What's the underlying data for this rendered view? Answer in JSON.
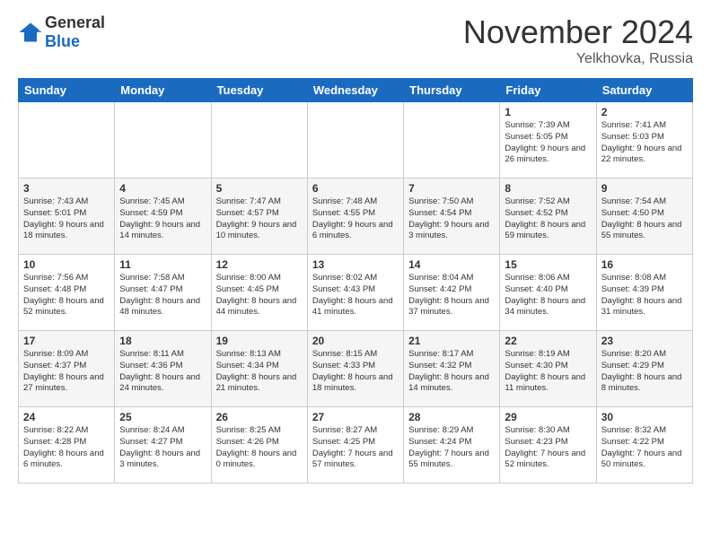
{
  "logo": {
    "general": "General",
    "blue": "Blue"
  },
  "header": {
    "month": "November 2024",
    "location": "Yelkhovka, Russia"
  },
  "days_of_week": [
    "Sunday",
    "Monday",
    "Tuesday",
    "Wednesday",
    "Thursday",
    "Friday",
    "Saturday"
  ],
  "weeks": [
    [
      {
        "day": "",
        "info": ""
      },
      {
        "day": "",
        "info": ""
      },
      {
        "day": "",
        "info": ""
      },
      {
        "day": "",
        "info": ""
      },
      {
        "day": "",
        "info": ""
      },
      {
        "day": "1",
        "info": "Sunrise: 7:39 AM\nSunset: 5:05 PM\nDaylight: 9 hours and 26 minutes."
      },
      {
        "day": "2",
        "info": "Sunrise: 7:41 AM\nSunset: 5:03 PM\nDaylight: 9 hours and 22 minutes."
      }
    ],
    [
      {
        "day": "3",
        "info": "Sunrise: 7:43 AM\nSunset: 5:01 PM\nDaylight: 9 hours and 18 minutes."
      },
      {
        "day": "4",
        "info": "Sunrise: 7:45 AM\nSunset: 4:59 PM\nDaylight: 9 hours and 14 minutes."
      },
      {
        "day": "5",
        "info": "Sunrise: 7:47 AM\nSunset: 4:57 PM\nDaylight: 9 hours and 10 minutes."
      },
      {
        "day": "6",
        "info": "Sunrise: 7:48 AM\nSunset: 4:55 PM\nDaylight: 9 hours and 6 minutes."
      },
      {
        "day": "7",
        "info": "Sunrise: 7:50 AM\nSunset: 4:54 PM\nDaylight: 9 hours and 3 minutes."
      },
      {
        "day": "8",
        "info": "Sunrise: 7:52 AM\nSunset: 4:52 PM\nDaylight: 8 hours and 59 minutes."
      },
      {
        "day": "9",
        "info": "Sunrise: 7:54 AM\nSunset: 4:50 PM\nDaylight: 8 hours and 55 minutes."
      }
    ],
    [
      {
        "day": "10",
        "info": "Sunrise: 7:56 AM\nSunset: 4:48 PM\nDaylight: 8 hours and 52 minutes."
      },
      {
        "day": "11",
        "info": "Sunrise: 7:58 AM\nSunset: 4:47 PM\nDaylight: 8 hours and 48 minutes."
      },
      {
        "day": "12",
        "info": "Sunrise: 8:00 AM\nSunset: 4:45 PM\nDaylight: 8 hours and 44 minutes."
      },
      {
        "day": "13",
        "info": "Sunrise: 8:02 AM\nSunset: 4:43 PM\nDaylight: 8 hours and 41 minutes."
      },
      {
        "day": "14",
        "info": "Sunrise: 8:04 AM\nSunset: 4:42 PM\nDaylight: 8 hours and 37 minutes."
      },
      {
        "day": "15",
        "info": "Sunrise: 8:06 AM\nSunset: 4:40 PM\nDaylight: 8 hours and 34 minutes."
      },
      {
        "day": "16",
        "info": "Sunrise: 8:08 AM\nSunset: 4:39 PM\nDaylight: 8 hours and 31 minutes."
      }
    ],
    [
      {
        "day": "17",
        "info": "Sunrise: 8:09 AM\nSunset: 4:37 PM\nDaylight: 8 hours and 27 minutes."
      },
      {
        "day": "18",
        "info": "Sunrise: 8:11 AM\nSunset: 4:36 PM\nDaylight: 8 hours and 24 minutes."
      },
      {
        "day": "19",
        "info": "Sunrise: 8:13 AM\nSunset: 4:34 PM\nDaylight: 8 hours and 21 minutes."
      },
      {
        "day": "20",
        "info": "Sunrise: 8:15 AM\nSunset: 4:33 PM\nDaylight: 8 hours and 18 minutes."
      },
      {
        "day": "21",
        "info": "Sunrise: 8:17 AM\nSunset: 4:32 PM\nDaylight: 8 hours and 14 minutes."
      },
      {
        "day": "22",
        "info": "Sunrise: 8:19 AM\nSunset: 4:30 PM\nDaylight: 8 hours and 11 minutes."
      },
      {
        "day": "23",
        "info": "Sunrise: 8:20 AM\nSunset: 4:29 PM\nDaylight: 8 hours and 8 minutes."
      }
    ],
    [
      {
        "day": "24",
        "info": "Sunrise: 8:22 AM\nSunset: 4:28 PM\nDaylight: 8 hours and 6 minutes."
      },
      {
        "day": "25",
        "info": "Sunrise: 8:24 AM\nSunset: 4:27 PM\nDaylight: 8 hours and 3 minutes."
      },
      {
        "day": "26",
        "info": "Sunrise: 8:25 AM\nSunset: 4:26 PM\nDaylight: 8 hours and 0 minutes."
      },
      {
        "day": "27",
        "info": "Sunrise: 8:27 AM\nSunset: 4:25 PM\nDaylight: 7 hours and 57 minutes."
      },
      {
        "day": "28",
        "info": "Sunrise: 8:29 AM\nSunset: 4:24 PM\nDaylight: 7 hours and 55 minutes."
      },
      {
        "day": "29",
        "info": "Sunrise: 8:30 AM\nSunset: 4:23 PM\nDaylight: 7 hours and 52 minutes."
      },
      {
        "day": "30",
        "info": "Sunrise: 8:32 AM\nSunset: 4:22 PM\nDaylight: 7 hours and 50 minutes."
      }
    ]
  ]
}
